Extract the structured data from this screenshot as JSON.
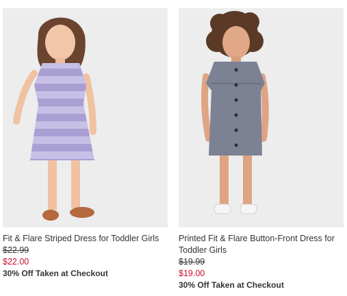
{
  "products": [
    {
      "name": "Fit & Flare Striped Dress for Toddler Girls",
      "original_price": "$22.99",
      "sale_price": "$22.00",
      "promo": "30% Off Taken at Checkout",
      "image_icon": "toddler-girl-striped-dress-photo"
    },
    {
      "name": "Printed Fit & Flare Button-Front Dress for Toddler Girls",
      "original_price": "$19.99",
      "sale_price": "$19.00",
      "promo": "30% Off Taken at Checkout",
      "image_icon": "toddler-girl-button-front-dress-photo"
    }
  ],
  "colors": {
    "sale_price": "#c8102e",
    "text": "#333333",
    "photo_background": "#ededed"
  }
}
